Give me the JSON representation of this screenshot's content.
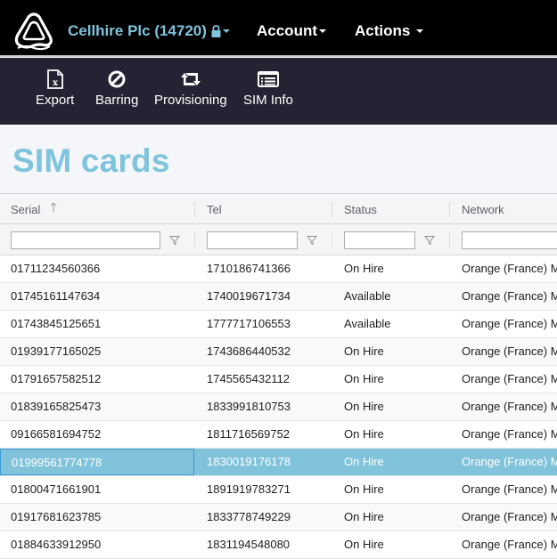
{
  "topbar": {
    "logo_icon": "triangle-wave-logo",
    "company": "Cellhire Plc (14720)",
    "lock_icon": "lock-icon",
    "account_label": "Account",
    "actions_label": "Actions"
  },
  "toolbar": {
    "items": [
      {
        "label": "Export",
        "icon": "excel-file-icon"
      },
      {
        "label": "Barring",
        "icon": "ban-icon"
      },
      {
        "label": "Provisioning",
        "icon": "retweet-icon"
      },
      {
        "label": "SIM Info",
        "icon": "list-card-icon"
      }
    ]
  },
  "page": {
    "title": "SIM cards"
  },
  "grid": {
    "columns": [
      {
        "label": "Serial",
        "sort": "ascending"
      },
      {
        "label": "Tel"
      },
      {
        "label": "Status"
      },
      {
        "label": "Network"
      }
    ],
    "filters": [
      "",
      "",
      "",
      ""
    ],
    "rows": [
      {
        "serial": "01711234560366",
        "tel": "1710186741366",
        "status": "On Hire",
        "network": "Orange (France) M"
      },
      {
        "serial": "01745161147634",
        "tel": "1740019671734",
        "status": "Available",
        "network": "Orange (France) M"
      },
      {
        "serial": "01743845125651",
        "tel": "1777717106553",
        "status": "Available",
        "network": "Orange (France) M"
      },
      {
        "serial": "01939177165025",
        "tel": "1743686440532",
        "status": "On Hire",
        "network": "Orange (France) M"
      },
      {
        "serial": "01791657582512",
        "tel": "1745565432112",
        "status": "On Hire",
        "network": "Orange (France) M"
      },
      {
        "serial": "01839165825473",
        "tel": "1833991810753",
        "status": "On Hire",
        "network": "Orange (France) M"
      },
      {
        "serial": "09166581694752",
        "tel": "1811716569752",
        "status": "On Hire",
        "network": "Orange (France) M"
      },
      {
        "serial": "01999561774778",
        "tel": "1830019176178",
        "status": "On Hire",
        "network": "Orange (France) M",
        "selected": true
      },
      {
        "serial": "01800471661901",
        "tel": "1891919783271",
        "status": "On Hire",
        "network": "Orange (France) M"
      },
      {
        "serial": "01917681623785",
        "tel": "1833778749229",
        "status": "On Hire",
        "network": "Orange (France) M"
      },
      {
        "serial": "01884633912950",
        "tel": "1831194548080",
        "status": "On Hire",
        "network": "Orange (France) M"
      }
    ]
  },
  "colors": {
    "accent": "#7ec4dc",
    "selected_row": "#80c3da",
    "toolbar_bg": "#232333",
    "topbar_bg": "#000000"
  }
}
